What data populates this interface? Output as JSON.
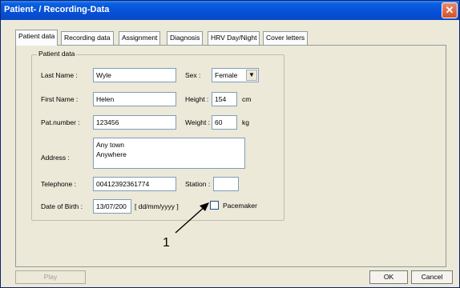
{
  "window": {
    "title": "Patient- / Recording-Data",
    "close_glyph": "✕"
  },
  "tabs": [
    {
      "label": "Patient data"
    },
    {
      "label": "Recording data"
    },
    {
      "label": "Assignment"
    },
    {
      "label": "Diagnosis"
    },
    {
      "label": "HRV Day/Night"
    },
    {
      "label": "Cover letters"
    }
  ],
  "patient_group": {
    "title": "Patient data",
    "last_name": {
      "label": "Last Name :",
      "value": "Wyle"
    },
    "first_name": {
      "label": "First Name :",
      "value": "Helen"
    },
    "pat_number": {
      "label": "Pat.number :",
      "value": "123456"
    },
    "address": {
      "label": "Address :",
      "value": "Any town\nAnywhere"
    },
    "telephone": {
      "label": "Telephone :",
      "value": "00412392361774"
    },
    "dob": {
      "label": "Date of Birth :",
      "value": "13/07/200",
      "format_hint": "[ dd/mm/yyyy ]"
    },
    "sex": {
      "label": "Sex :",
      "value": "Female"
    },
    "height": {
      "label": "Height :",
      "value": "154",
      "unit": "cm"
    },
    "weight": {
      "label": "Weight :",
      "value": "60",
      "unit": "kg"
    },
    "station": {
      "label": "Station :",
      "value": ""
    },
    "pacemaker": {
      "label": "Pacemaker",
      "checked": false
    }
  },
  "callout": {
    "number": "1"
  },
  "buttons": {
    "play": "Play",
    "ok": "OK",
    "cancel": "Cancel"
  }
}
